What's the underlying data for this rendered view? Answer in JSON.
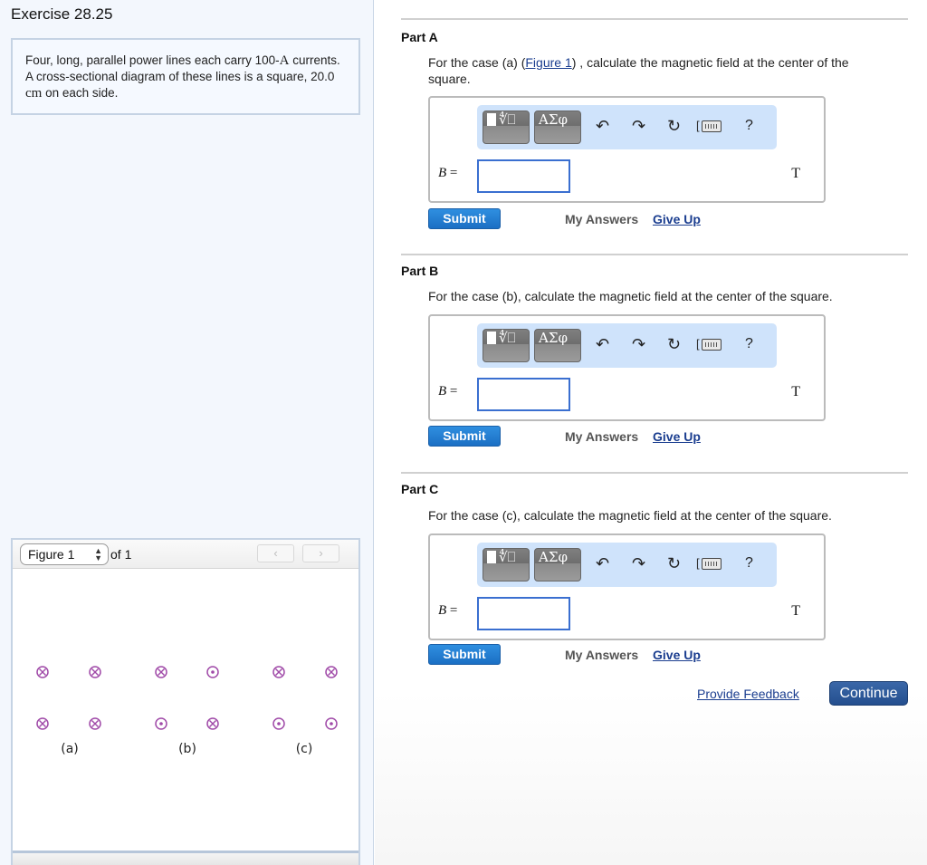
{
  "exercise": {
    "title": "Exercise 28.25",
    "problem": {
      "text_before_current": "Four, long, parallel power lines each carry 100-",
      "current_unit": "A",
      "text_middle": " currents. A cross-sectional diagram of these lines is a square, 20.0 ",
      "length_unit": "cm",
      "text_after": " on each side."
    }
  },
  "figure_panel": {
    "selected": "Figure 1",
    "of_label": "of 1",
    "prev_icon": "chevron-left-icon",
    "next_icon": "chevron-right-icon",
    "prev_glyph": "‹",
    "next_glyph": "›",
    "cases": [
      {
        "label": "(a)",
        "wires": [
          "into",
          "into",
          "into",
          "into"
        ]
      },
      {
        "label": "(b)",
        "wires": [
          "into",
          "out",
          "out",
          "into"
        ]
      },
      {
        "label": "(c)",
        "wires": [
          "into",
          "into",
          "out",
          "out"
        ]
      }
    ],
    "wire_color": "#a04aa8"
  },
  "toolbar": {
    "template_glyph": "∜⎕",
    "greek_glyph": "ΑΣφ",
    "undo_glyph": "↶",
    "redo_glyph": "↷",
    "reset_glyph": "↻",
    "bracket_glyph": "[",
    "help_glyph": "?"
  },
  "parts": [
    {
      "title": "Part A",
      "text_before_link": "For the case (a) (",
      "link": "Figure 1",
      "text_after_link": ") , calculate the magnetic field at the center of the square.",
      "variable": "B",
      "equals": " =",
      "input_value": "",
      "unit": "T",
      "submit": "Submit",
      "my_answers": "My Answers",
      "give_up": "Give Up"
    },
    {
      "title": "Part B",
      "text": "For the case (b), calculate the magnetic field at the center of the square.",
      "variable": "B",
      "equals": " =",
      "input_value": "",
      "unit": "T",
      "submit": "Submit",
      "my_answers": "My Answers",
      "give_up": "Give Up"
    },
    {
      "title": "Part C",
      "text": "For the case (c), calculate the magnetic field at the center of the square.",
      "variable": "B",
      "equals": " =",
      "input_value": "",
      "unit": "T",
      "submit": "Submit",
      "my_answers": "My Answers",
      "give_up": "Give Up"
    }
  ],
  "footer": {
    "feedback": "Provide Feedback",
    "continue": "Continue"
  },
  "colors": {
    "link": "#1a3d8f",
    "submit": "#1b6fc4",
    "continue": "#244f8f",
    "toolbar_bg": "#cfe3fb",
    "input_border": "#3a6fd0"
  }
}
